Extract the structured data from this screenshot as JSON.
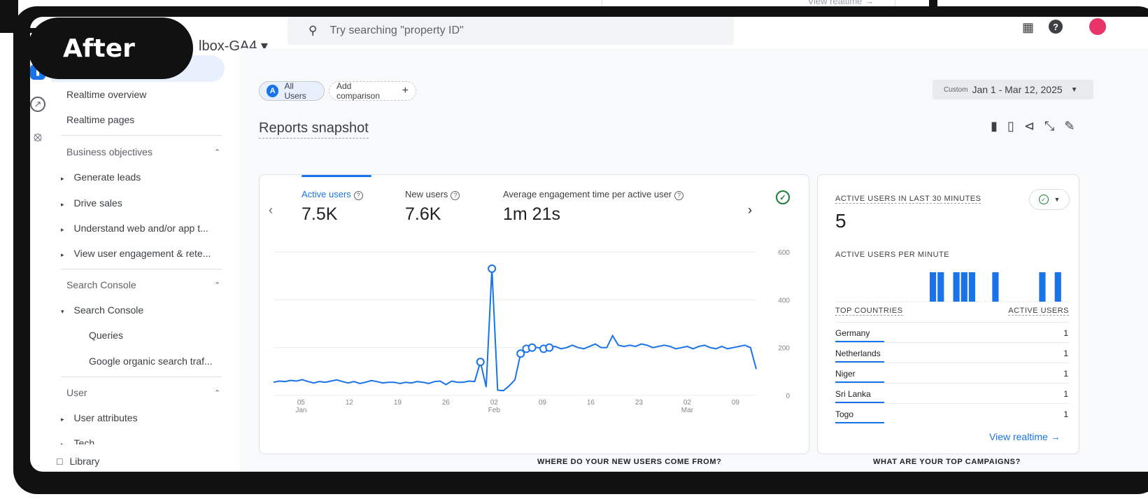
{
  "badge": "After",
  "background": {
    "view_realtime_ghost": "View realtime →"
  },
  "topbar": {
    "property_name": "lbox-GA4 ▾",
    "search_placeholder": "Try searching \"property ID\""
  },
  "sidebar": {
    "items": [
      "Realtime overview",
      "Realtime pages"
    ],
    "sections": [
      {
        "title": "Business objectives",
        "items": [
          "Generate leads",
          "Drive sales",
          "Understand web and/or app t...",
          "View user engagement & rete..."
        ]
      },
      {
        "title": "Search Console",
        "group": "Search Console",
        "subitems": [
          "Queries",
          "Google organic search traf..."
        ]
      },
      {
        "title": "User",
        "items": [
          "User attributes",
          "Tech"
        ]
      }
    ],
    "library": "Library"
  },
  "comparisons": {
    "all_users_initial": "A",
    "all_users": "All Users",
    "add": "Add comparison",
    "add_icon": "+"
  },
  "date": {
    "custom": "Custom",
    "range": "Jan 1 - Mar 12, 2025"
  },
  "snapshot": {
    "title": "Reports snapshot",
    "metrics": [
      {
        "label": "Active users",
        "value": "7.5K"
      },
      {
        "label": "New users",
        "value": "7.6K"
      },
      {
        "label": "Average engagement time per active user",
        "value": "1m 21s"
      }
    ]
  },
  "chart_data": {
    "type": "line",
    "yticks": [
      "600",
      "400",
      "200",
      "0"
    ],
    "ylim": [
      0,
      600
    ],
    "xtick_labels": [
      {
        "d": "05",
        "m": "Jan"
      },
      {
        "d": "12",
        "m": ""
      },
      {
        "d": "19",
        "m": ""
      },
      {
        "d": "26",
        "m": ""
      },
      {
        "d": "02",
        "m": "Feb"
      },
      {
        "d": "09",
        "m": ""
      },
      {
        "d": "16",
        "m": ""
      },
      {
        "d": "23",
        "m": ""
      },
      {
        "d": "02",
        "m": "Mar"
      },
      {
        "d": "09",
        "m": ""
      }
    ],
    "x_start": "2025-01-01",
    "x_end": "2025-03-12",
    "series": [
      {
        "values": [
          55,
          60,
          58,
          63,
          60,
          66,
          58,
          52,
          58,
          55,
          60,
          65,
          58,
          52,
          58,
          50,
          55,
          62,
          58,
          52,
          55,
          55,
          50,
          55,
          52,
          58,
          55,
          50,
          58,
          60,
          45,
          60,
          55,
          55,
          60,
          58,
          140,
          35,
          530,
          22,
          20,
          40,
          65,
          175,
          195,
          200,
          200,
          195,
          200,
          205,
          195,
          200,
          210,
          200,
          195,
          205,
          215,
          200,
          200,
          250,
          210,
          205,
          210,
          205,
          215,
          210,
          200,
          205,
          210,
          205,
          195,
          200,
          205,
          195,
          205,
          210,
          200,
          195,
          205,
          195,
          200,
          205,
          210,
          200,
          110
        ]
      }
    ]
  },
  "realtime": {
    "title": "ACTIVE USERS IN LAST 30 MINUTES",
    "count": "5",
    "per_minute_label": "ACTIVE USERS PER MINUTE",
    "per_minute": [
      0,
      0,
      0,
      0,
      0,
      0,
      0,
      0,
      0,
      0,
      0,
      0,
      1,
      1,
      0,
      1,
      1,
      1,
      0,
      0,
      1,
      0,
      0,
      0,
      0,
      0,
      1,
      0,
      1,
      0
    ],
    "top_countries_label": "TOP COUNTRIES",
    "active_users_label": "ACTIVE USERS",
    "countries": [
      {
        "name": "Germany",
        "users": "1"
      },
      {
        "name": "Netherlands",
        "users": "1"
      },
      {
        "name": "Niger",
        "users": "1"
      },
      {
        "name": "Sri Lanka",
        "users": "1"
      },
      {
        "name": "Togo",
        "users": "1"
      }
    ],
    "view_link": "View realtime →"
  },
  "bottom": {
    "new_users_q": "WHERE DO YOUR NEW USERS COME FROM?",
    "campaigns_q": "WHAT ARE YOUR TOP CAMPAIGNS?"
  },
  "colors": {
    "accent": "#1a73e8",
    "success": "#188038"
  }
}
